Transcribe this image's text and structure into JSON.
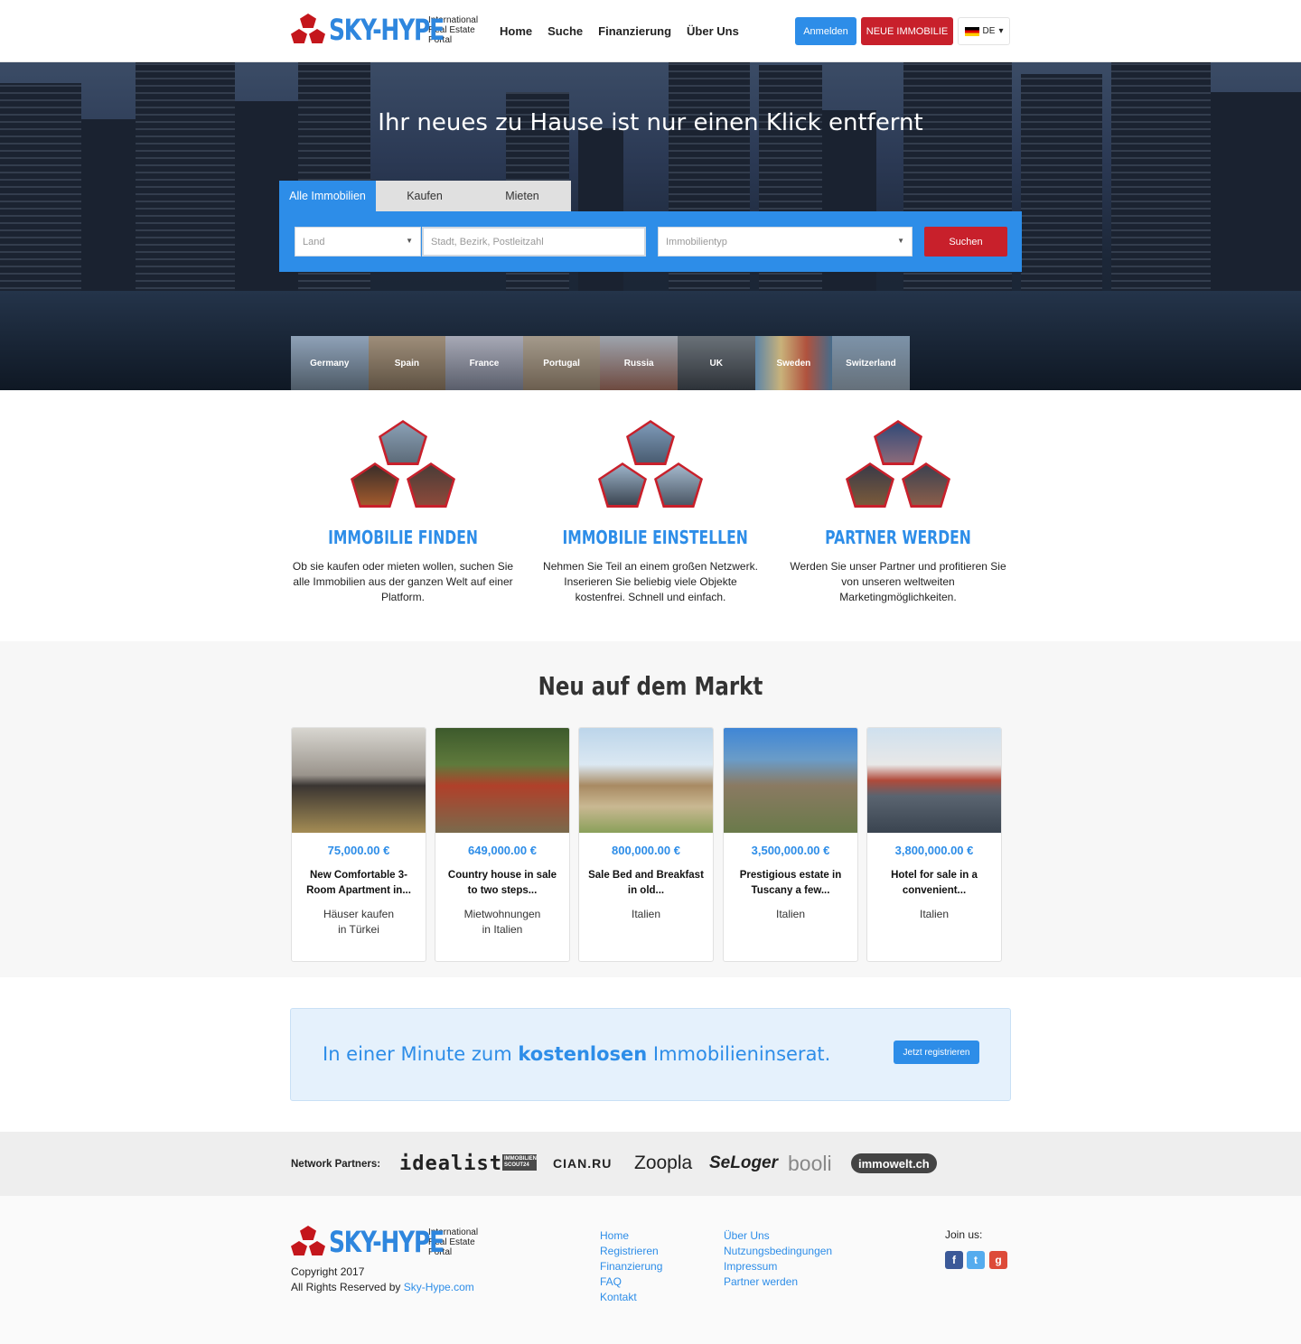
{
  "brand": {
    "name": "SKY-HYPE",
    "tagline_1": "International",
    "tagline_2": "Real Estate",
    "tagline_3": "Portal"
  },
  "nav": {
    "home": "Home",
    "search": "Suche",
    "financing": "Finanzierung",
    "about": "Über Uns"
  },
  "header_actions": {
    "login": "Anmelden",
    "new_property": "NEUE IMMOBILIE",
    "language": "DE"
  },
  "hero": {
    "title": "Ihr neues zu Hause ist nur einen Klick entfernt",
    "tabs": [
      "Alle Immobilien",
      "Kaufen",
      "Mieten"
    ],
    "country_placeholder": "Land",
    "location_placeholder": "Stadt, Bezirk, Postleitzahl",
    "type_placeholder": "Immobilientyp",
    "search_button": "Suchen",
    "countries": [
      "Germany",
      "Spain",
      "France",
      "Portugal",
      "Russia",
      "UK",
      "Sweden",
      "Switzerland"
    ]
  },
  "features": [
    {
      "title": "IMMOBILIE FINDEN",
      "text": "Ob sie kaufen oder mieten wollen, suchen Sie alle Immobilien aus der ganzen Welt auf einer Platform."
    },
    {
      "title": "IMMOBILIE EINSTELLEN",
      "text": "Nehmen Sie Teil an einem großen Netzwerk. Inserieren Sie beliebig viele Objekte kostenfrei. Schnell und einfach."
    },
    {
      "title": "PARTNER WERDEN",
      "text": "Werden Sie unser Partner und profitieren Sie von unseren weltweiten Marketingmöglichkeiten."
    }
  ],
  "market": {
    "title": "Neu auf dem Markt",
    "cards": [
      {
        "price": "75,000.00 €",
        "title": "New Comfortable 3-Room Apartment in...",
        "loc1": "Häuser kaufen",
        "loc2": "in Türkei"
      },
      {
        "price": "649,000.00 €",
        "title": "Country house in sale to two steps...",
        "loc1": "Mietwohnungen",
        "loc2": "in Italien"
      },
      {
        "price": "800,000.00 €",
        "title": "Sale Bed and Breakfast in old...",
        "loc1": "Italien",
        "loc2": ""
      },
      {
        "price": "3,500,000.00 €",
        "title": "Prestigious estate in Tuscany a few...",
        "loc1": "Italien",
        "loc2": ""
      },
      {
        "price": "3,800,000.00 €",
        "title": "Hotel for sale in a convenient...",
        "loc1": "Italien",
        "loc2": ""
      }
    ]
  },
  "promo": {
    "text_1": "In einer Minute zum ",
    "text_bold": "kostenlosen",
    "text_2": " Immobilieninserat.",
    "button": "Jetzt registrieren"
  },
  "partners": {
    "label": "Network Partners:",
    "logos": [
      "idealista",
      "IMMOBILIEN SCOUT24",
      "CIAN.RU",
      "Zoopla",
      "SeLoger",
      "booli",
      "immowelt.ch"
    ]
  },
  "footer": {
    "copyright": "Copyright 2017",
    "rights": "All Rights Reserved by ",
    "rights_link": "Sky-Hype.com",
    "col1": [
      "Home",
      "Registrieren",
      "Finanzierung",
      "FAQ",
      "Kontakt"
    ],
    "col2": [
      "Über Uns",
      "Nutzungsbedingungen",
      "Impressum",
      "Partner werden"
    ],
    "join": "Join us:",
    "social": [
      "facebook",
      "twitter",
      "google-plus"
    ]
  },
  "colors": {
    "accent_blue": "#2d8de8",
    "accent_red": "#c8202b"
  }
}
